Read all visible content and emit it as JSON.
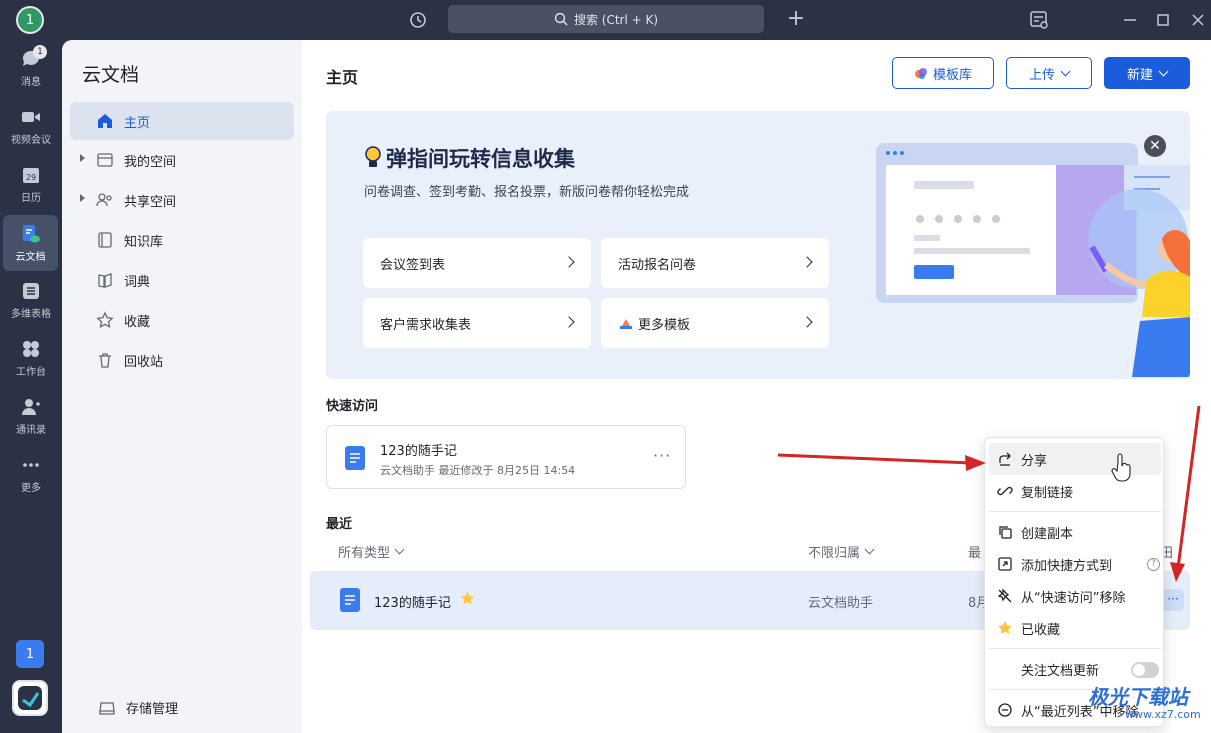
{
  "titlebar": {
    "avatar": "1",
    "search_placeholder": "搜索 (Ctrl + K)"
  },
  "leftnav": {
    "badge": "1",
    "items": [
      {
        "label": "消息",
        "icon": "message-icon"
      },
      {
        "label": "视频会议",
        "icon": "video-icon"
      },
      {
        "label": "日历",
        "icon": "calendar-icon",
        "day": "29"
      },
      {
        "label": "云文档",
        "icon": "cloud-doc-icon"
      },
      {
        "label": "多维表格",
        "icon": "table-icon"
      },
      {
        "label": "工作台",
        "icon": "workbench-icon"
      },
      {
        "label": "通讯录",
        "icon": "contacts-icon"
      },
      {
        "label": "更多",
        "icon": "more-icon"
      }
    ],
    "user": "1"
  },
  "sidebar": {
    "title": "云文档",
    "items": [
      {
        "label": "主页",
        "icon": "home-icon"
      },
      {
        "label": "我的空间",
        "icon": "folder-icon"
      },
      {
        "label": "共享空间",
        "icon": "shared-icon"
      },
      {
        "label": "知识库",
        "icon": "knowledge-icon"
      },
      {
        "label": "词典",
        "icon": "dictionary-icon"
      },
      {
        "label": "收藏",
        "icon": "star-icon"
      },
      {
        "label": "回收站",
        "icon": "trash-icon"
      }
    ],
    "storage": "存储管理"
  },
  "main": {
    "title": "主页",
    "buttons": {
      "template": "模板库",
      "upload": "上传",
      "new": "新建"
    },
    "banner": {
      "title": "弹指间玩转信息收集",
      "subtitle": "问卷调查、签到考勤、报名投票，新版问卷帮你轻松完成",
      "cards": [
        "会议签到表",
        "活动报名问卷",
        "客户需求收集表",
        "更多模板"
      ]
    },
    "quick_access": {
      "heading": "快速访问",
      "doc_name": "123的随手记",
      "doc_meta": "云文档助手  最近修改于 8月25日 14:54",
      "more": "···"
    },
    "recent": {
      "heading": "最近",
      "filter_type": "所有类型",
      "filter_owner": "不限归属",
      "col_partial": "最",
      "col_partial2": "田",
      "row": {
        "name": "123的随手记",
        "owner": "云文档助手",
        "date_partial": "8月",
        "more": "···"
      }
    }
  },
  "context_menu": {
    "items": [
      {
        "label": "分享",
        "icon": "share-icon"
      },
      {
        "label": "复制链接",
        "icon": "link-icon"
      },
      {
        "label": "创建副本",
        "icon": "copy-icon"
      },
      {
        "label": "添加快捷方式到",
        "icon": "shortcut-icon"
      },
      {
        "label": "从“快速访问”移除",
        "icon": "unpin-icon"
      },
      {
        "label": "已收藏",
        "icon": "star-filled-icon"
      },
      {
        "label": "关注文档更新",
        "icon": ""
      },
      {
        "label": "从“最近列表”中移除",
        "icon": "remove-icon"
      }
    ],
    "follow_updates_on": false
  },
  "watermark": {
    "title": "极光下载站",
    "url": "www.xz7.com"
  },
  "colors": {
    "accent": "#1a5cdc",
    "nav_bg": "#2b3245",
    "annotation": "#d42424"
  }
}
